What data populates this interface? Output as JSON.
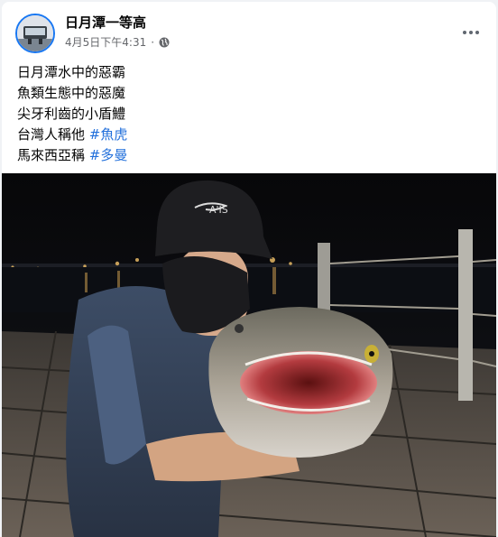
{
  "post": {
    "page_name": "日月潭一等高",
    "timestamp": "4月5日下午4:31",
    "separator": "·",
    "privacy_icon": "globe-icon",
    "more_icon": "more-horizontal-icon",
    "lines": [
      {
        "text": "日月潭水中的惡霸"
      },
      {
        "text": "魚類生態中的惡魔"
      },
      {
        "text": "尖牙利齒的小盾鱧"
      },
      {
        "text": "台灣人稱他 ",
        "hashtag": "#魚虎"
      },
      {
        "text": "馬來西亞稱 ",
        "hashtag": "#多曼"
      }
    ],
    "photo": {
      "cap_logo": "A'IS"
    }
  },
  "colors": {
    "link": "#216fdb",
    "secondary_text": "#65676b",
    "avatar_ring": "#1877f2"
  }
}
